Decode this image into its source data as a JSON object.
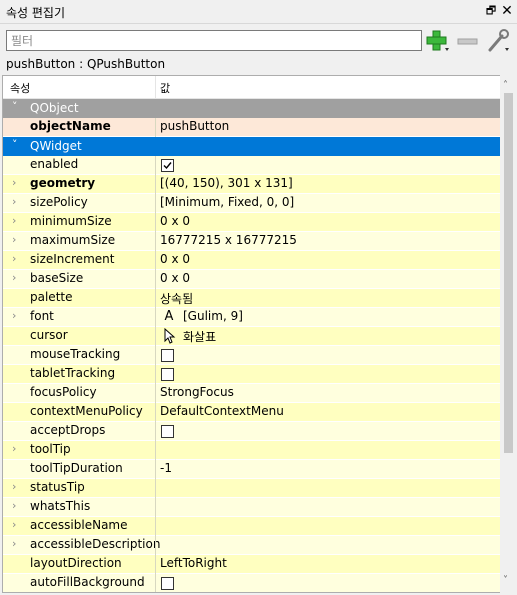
{
  "window": {
    "title": "속성 편집기",
    "float_glyph": "🗗",
    "close_glyph": "✕"
  },
  "toolbar": {
    "filter_placeholder": "필터",
    "add_icon": "plus-icon",
    "remove_icon": "minus-icon",
    "config_icon": "wrench-icon"
  },
  "object_line": "pushButton : QPushButton",
  "header": {
    "property": "속성",
    "value": "값"
  },
  "groups": {
    "qobject": "QObject",
    "qwidget": "QWidget"
  },
  "rows": [
    {
      "name": "objectName",
      "value": "pushButton"
    },
    {
      "name": "enabled",
      "checked": true
    },
    {
      "name": "geometry",
      "value": "[(40, 150), 301 x 131]"
    },
    {
      "name": "sizePolicy",
      "value": "[Minimum, Fixed, 0, 0]"
    },
    {
      "name": "minimumSize",
      "value": "0 x 0"
    },
    {
      "name": "maximumSize",
      "value": "16777215 x 16777215"
    },
    {
      "name": "sizeIncrement",
      "value": "0 x 0"
    },
    {
      "name": "baseSize",
      "value": "0 x 0"
    },
    {
      "name": "palette",
      "value": "상속됨"
    },
    {
      "name": "font",
      "value": "[Gulim, 9]",
      "icon": "A"
    },
    {
      "name": "cursor",
      "value": "화살표",
      "icon": "arrow-cursor"
    },
    {
      "name": "mouseTracking",
      "checked": false
    },
    {
      "name": "tabletTracking",
      "checked": false
    },
    {
      "name": "focusPolicy",
      "value": "StrongFocus"
    },
    {
      "name": "contextMenuPolicy",
      "value": "DefaultContextMenu"
    },
    {
      "name": "acceptDrops",
      "checked": false
    },
    {
      "name": "toolTip",
      "value": ""
    },
    {
      "name": "toolTipDuration",
      "value": "-1"
    },
    {
      "name": "statusTip",
      "value": ""
    },
    {
      "name": "whatsThis",
      "value": ""
    },
    {
      "name": "accessibleName",
      "value": ""
    },
    {
      "name": "accessibleDescription",
      "value": ""
    },
    {
      "name": "layoutDirection",
      "value": "LeftToRight"
    },
    {
      "name": "autoFillBackground",
      "checked": false
    }
  ],
  "colors": {
    "selected_group": "#0078d7",
    "object_group": "#a0a0a0",
    "row_light": "#ffffde",
    "row_dark": "#ffffc0",
    "accent_add": "#3cb83c"
  }
}
